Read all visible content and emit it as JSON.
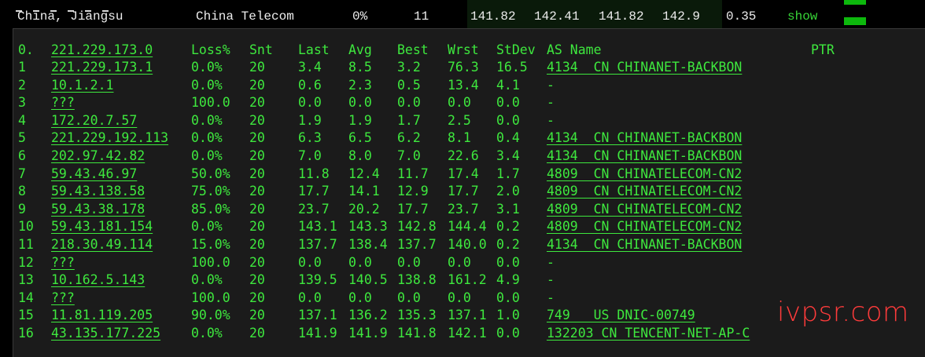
{
  "summary": {
    "location": "China, Jiangsu",
    "isp": "China Telecom",
    "loss": "0%",
    "sent": "11",
    "last": "141.82",
    "avg": "142.41",
    "best": "141.82",
    "worst": "142.9",
    "stdev": "0.35",
    "show_label": "show"
  },
  "colors": {
    "terminal_text": "#3ee83e",
    "terminal_bg": "#1b1b1b",
    "watermark": "#ff3b3b",
    "bar": "#0db80d"
  },
  "table": {
    "headers": {
      "hop": "0.",
      "host": "221.229.173.0",
      "loss": "Loss%",
      "snt": "Snt",
      "last": "Last",
      "avg": "Avg",
      "best": "Best",
      "wrst": "Wrst",
      "stdev": "StDev",
      "asname": "AS Name",
      "ptr": "PTR"
    },
    "rows": [
      {
        "hop": "1",
        "host": "221.229.173.1",
        "loss": "0.0%",
        "snt": "20",
        "last": "3.4",
        "avg": "8.5",
        "best": "3.2",
        "wrst": "76.3",
        "stdev": "16.5",
        "asname": "4134  CN CHINANET-BACKBON"
      },
      {
        "hop": "2",
        "host": "10.1.2.1",
        "loss": "0.0%",
        "snt": "20",
        "last": "0.6",
        "avg": "2.3",
        "best": "0.5",
        "wrst": "13.4",
        "stdev": "4.1",
        "asname": "-"
      },
      {
        "hop": "3",
        "host": "???",
        "loss": "100.0",
        "snt": "20",
        "last": "0.0",
        "avg": "0.0",
        "best": "0.0",
        "wrst": "0.0",
        "stdev": "0.0",
        "asname": "-"
      },
      {
        "hop": "4",
        "host": "172.20.7.57",
        "loss": "0.0%",
        "snt": "20",
        "last": "1.9",
        "avg": "1.9",
        "best": "1.7",
        "wrst": "2.5",
        "stdev": "0.0",
        "asname": "-"
      },
      {
        "hop": "5",
        "host": "221.229.192.113",
        "loss": "0.0%",
        "snt": "20",
        "last": "6.3",
        "avg": "6.5",
        "best": "6.2",
        "wrst": "8.1",
        "stdev": "0.4",
        "asname": "4134  CN CHINANET-BACKBON"
      },
      {
        "hop": "6",
        "host": "202.97.42.82",
        "loss": "0.0%",
        "snt": "20",
        "last": "7.0",
        "avg": "8.0",
        "best": "7.0",
        "wrst": "22.6",
        "stdev": "3.4",
        "asname": "4134  CN CHINANET-BACKBON"
      },
      {
        "hop": "7",
        "host": "59.43.46.97",
        "loss": "50.0%",
        "snt": "20",
        "last": "11.8",
        "avg": "12.4",
        "best": "11.7",
        "wrst": "17.4",
        "stdev": "1.7",
        "asname": "4809  CN CHINATELECOM-CN2"
      },
      {
        "hop": "8",
        "host": "59.43.138.58",
        "loss": "75.0%",
        "snt": "20",
        "last": "17.7",
        "avg": "14.1",
        "best": "12.9",
        "wrst": "17.7",
        "stdev": "2.0",
        "asname": "4809  CN CHINATELECOM-CN2"
      },
      {
        "hop": "9",
        "host": "59.43.38.178",
        "loss": "85.0%",
        "snt": "20",
        "last": "23.7",
        "avg": "20.2",
        "best": "17.7",
        "wrst": "23.7",
        "stdev": "3.1",
        "asname": "4809  CN CHINATELECOM-CN2"
      },
      {
        "hop": "10",
        "host": "59.43.181.154",
        "loss": "0.0%",
        "snt": "20",
        "last": "143.1",
        "avg": "143.3",
        "best": "142.8",
        "wrst": "144.4",
        "stdev": "0.2",
        "asname": "4809  CN CHINATELECOM-CN2"
      },
      {
        "hop": "11",
        "host": "218.30.49.114",
        "loss": "15.0%",
        "snt": "20",
        "last": "137.7",
        "avg": "138.4",
        "best": "137.7",
        "wrst": "140.0",
        "stdev": "0.2",
        "asname": "4134  CN CHINANET-BACKBON"
      },
      {
        "hop": "12",
        "host": "???",
        "loss": "100.0",
        "snt": "20",
        "last": "0.0",
        "avg": "0.0",
        "best": "0.0",
        "wrst": "0.0",
        "stdev": "0.0",
        "asname": "-"
      },
      {
        "hop": "13",
        "host": "10.162.5.143",
        "loss": "0.0%",
        "snt": "20",
        "last": "139.5",
        "avg": "140.5",
        "best": "138.8",
        "wrst": "161.2",
        "stdev": "4.9",
        "asname": "-"
      },
      {
        "hop": "14",
        "host": "???",
        "loss": "100.0",
        "snt": "20",
        "last": "0.0",
        "avg": "0.0",
        "best": "0.0",
        "wrst": "0.0",
        "stdev": "0.0",
        "asname": "-"
      },
      {
        "hop": "15",
        "host": "11.81.119.205",
        "loss": "90.0%",
        "snt": "20",
        "last": "137.1",
        "avg": "136.2",
        "best": "135.3",
        "wrst": "137.1",
        "stdev": "1.0",
        "asname": "749   US DNIC-00749"
      },
      {
        "hop": "16",
        "host": "43.135.177.225",
        "loss": "0.0%",
        "snt": "20",
        "last": "141.9",
        "avg": "141.9",
        "best": "141.8",
        "wrst": "142.1",
        "stdev": "0.0",
        "asname": "132203 CN TENCENT-NET-AP-C"
      }
    ]
  },
  "watermark": "ivpsr.com"
}
